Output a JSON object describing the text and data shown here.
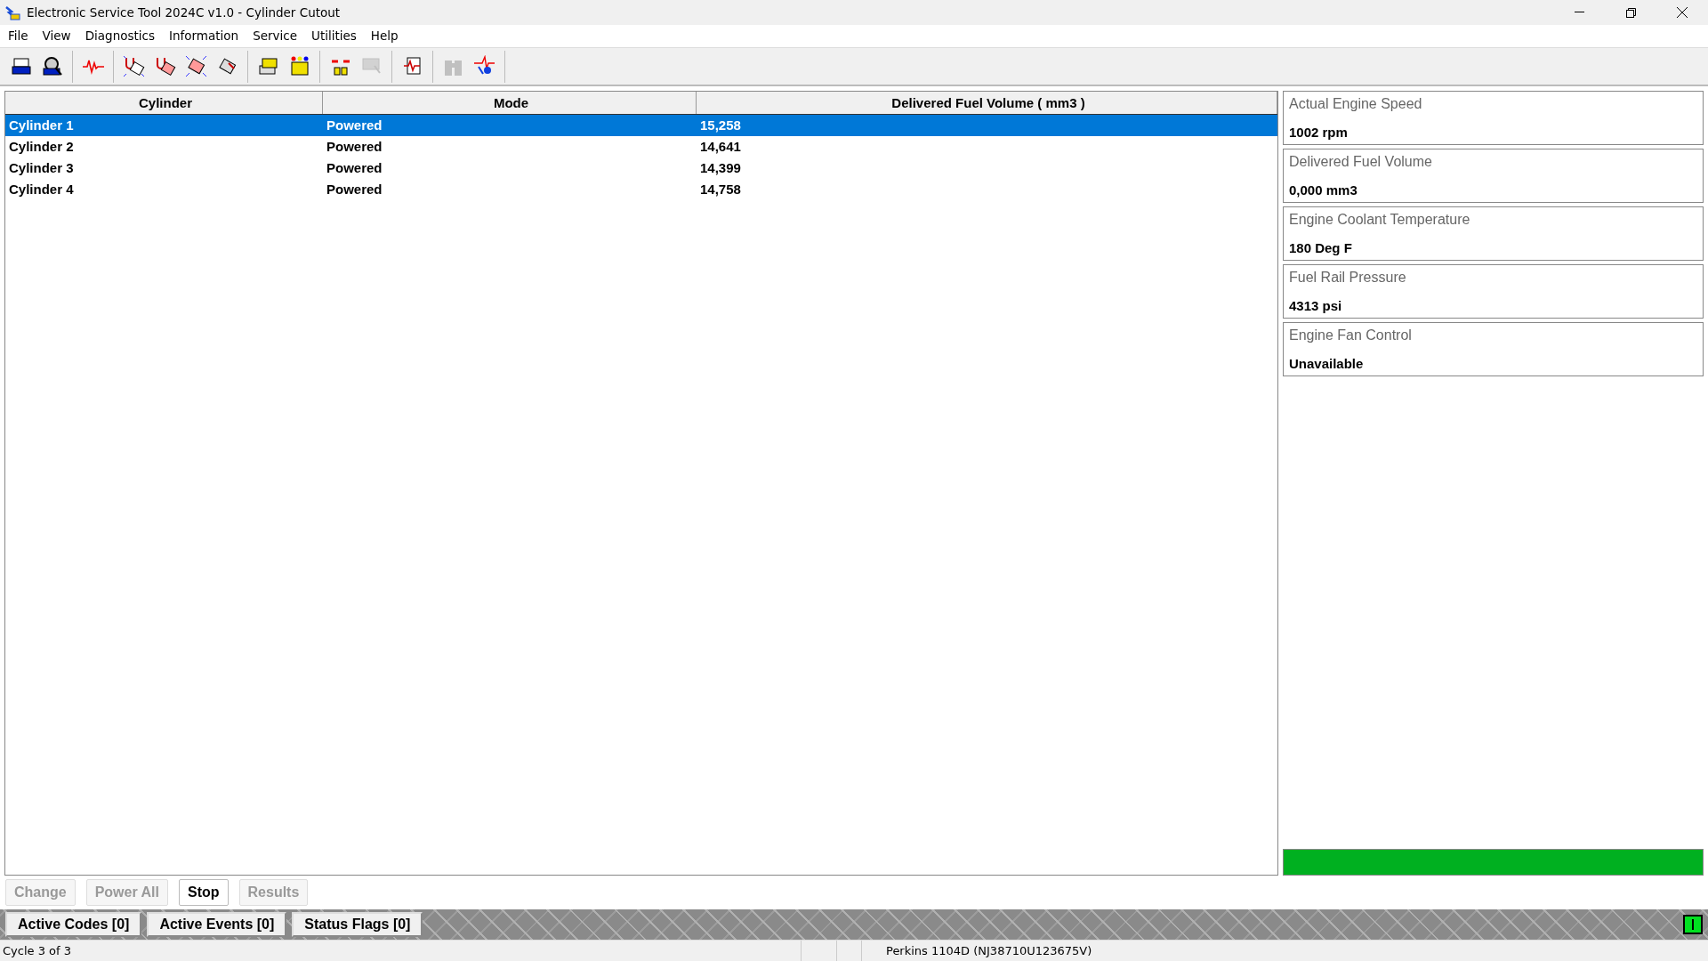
{
  "window": {
    "title": "Electronic Service Tool 2024C v1.0 - Cylinder Cutout"
  },
  "menu": [
    "File",
    "View",
    "Diagnostics",
    "Information",
    "Service",
    "Utilities",
    "Help"
  ],
  "toolbar": [
    [
      {
        "disabled": false
      },
      {
        "disabled": false
      }
    ],
    [
      {
        "disabled": false
      }
    ],
    [
      {
        "disabled": false
      },
      {
        "disabled": false
      },
      {
        "disabled": false
      },
      {
        "disabled": false
      }
    ],
    [
      {
        "disabled": false
      },
      {
        "disabled": false
      }
    ],
    [
      {
        "disabled": false
      },
      {
        "disabled": true
      }
    ],
    [
      {
        "disabled": false
      }
    ],
    [
      {
        "disabled": true
      },
      {
        "disabled": false
      }
    ]
  ],
  "table": {
    "columns": [
      "Cylinder",
      "Mode",
      "Delivered Fuel Volume ( mm3 )"
    ],
    "rows": [
      {
        "cells": [
          "Cylinder 1",
          "Powered",
          "15,258"
        ],
        "selected": true
      },
      {
        "cells": [
          "Cylinder 2",
          "Powered",
          "14,641"
        ],
        "selected": false
      },
      {
        "cells": [
          "Cylinder 3",
          "Powered",
          "14,399"
        ],
        "selected": false
      },
      {
        "cells": [
          "Cylinder 4",
          "Powered",
          "14,758"
        ],
        "selected": false
      }
    ]
  },
  "parameters": [
    {
      "label": "Actual Engine Speed",
      "value": "1002 rpm"
    },
    {
      "label": "Delivered Fuel Volume",
      "value": "0,000 mm3"
    },
    {
      "label": "Engine Coolant Temperature",
      "value": "180 Deg F"
    },
    {
      "label": "Fuel Rail Pressure",
      "value": "4313 psi"
    },
    {
      "label": "Engine Fan Control",
      "value": "Unavailable"
    }
  ],
  "progress": {
    "level": 1
  },
  "buttons": [
    {
      "label": "Change",
      "disabled": true
    },
    {
      "label": "Power All",
      "disabled": true
    },
    {
      "label": "Stop",
      "disabled": false
    },
    {
      "label": "Results",
      "disabled": true
    }
  ],
  "summary_buttons": [
    "Active Codes [0]",
    "Active Events [0]",
    "Status Flags [0]"
  ],
  "status_bar": {
    "left": "Cycle 3 of 3",
    "right": "Perkins 1104D (NJ38710U123675V)"
  }
}
